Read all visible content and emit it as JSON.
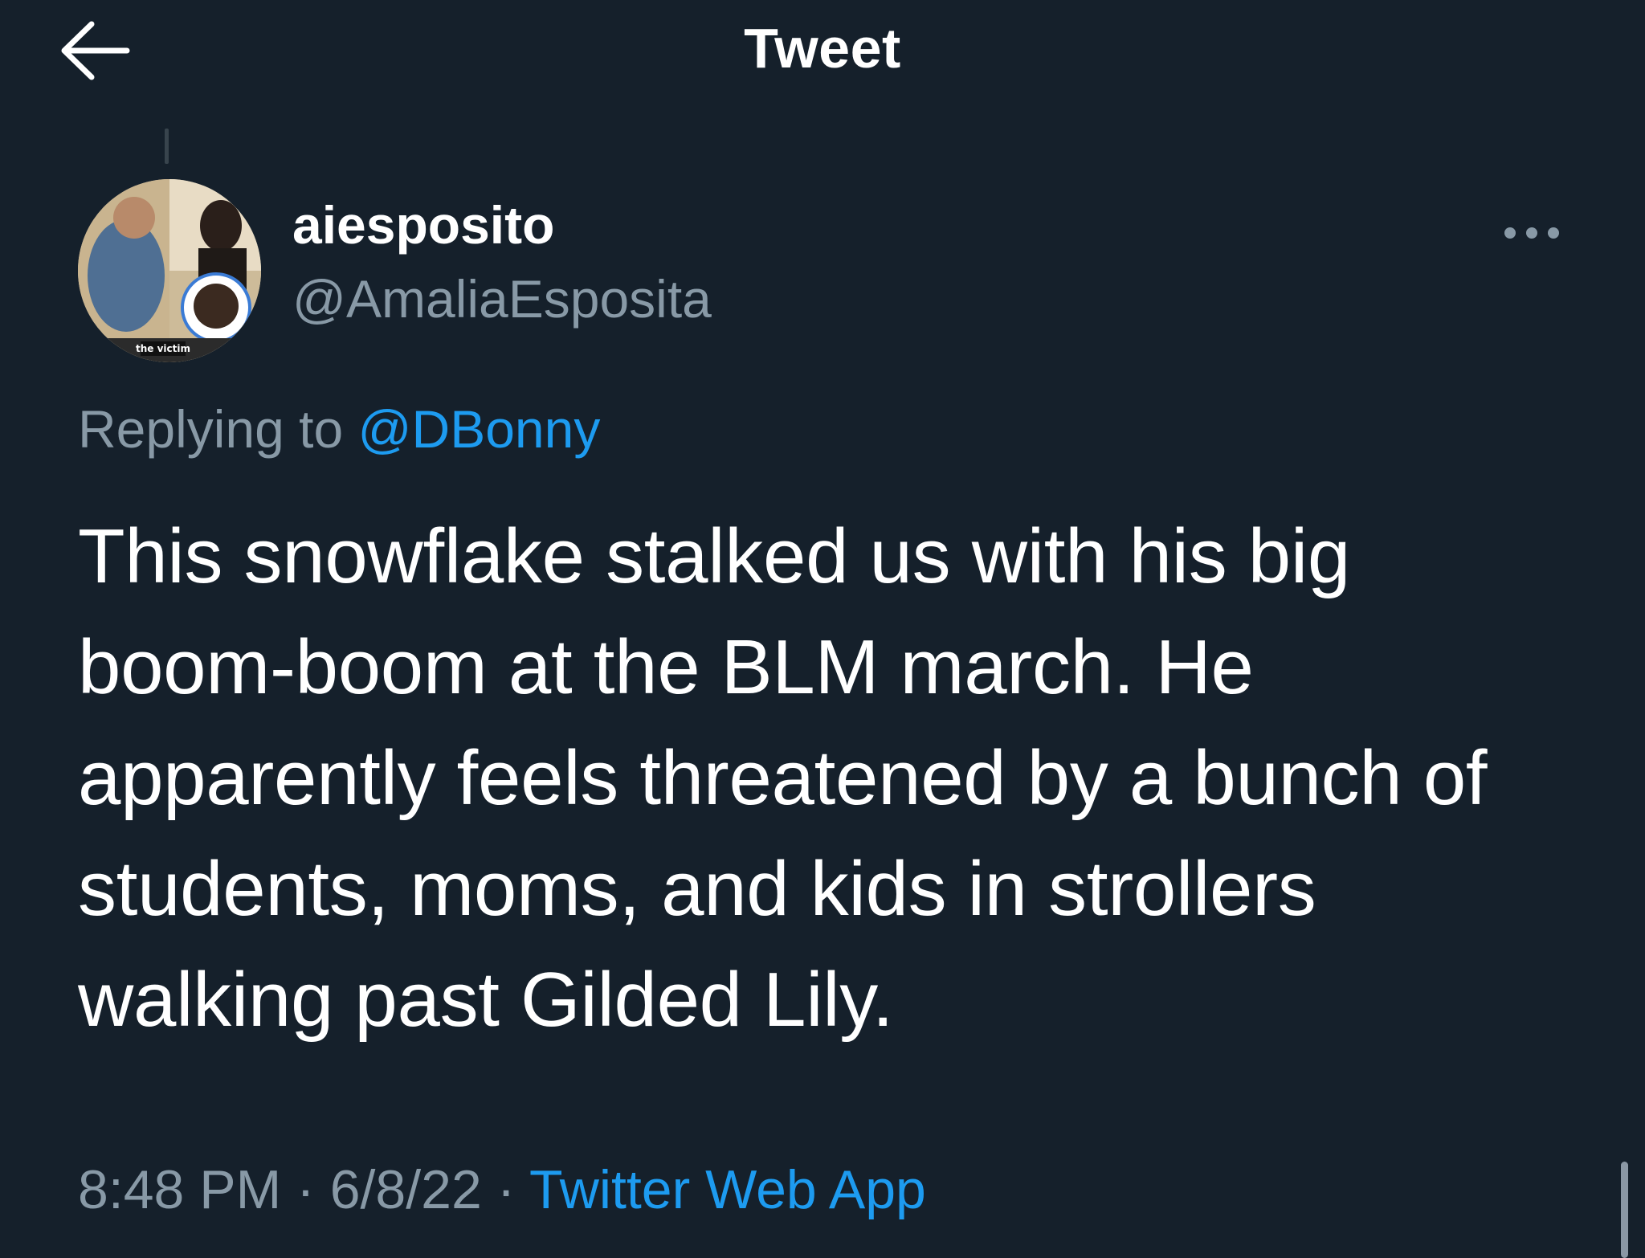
{
  "header": {
    "title": "Tweet",
    "back_icon": "arrow-left-icon"
  },
  "tweet": {
    "author": {
      "display_name": "aiesposito",
      "handle": "@AmaliaEsposita",
      "avatar_caption": "the victim"
    },
    "more_icon": "more-horizontal-icon",
    "replying_to_label": "Replying to",
    "replying_to_handle": "@DBonny",
    "text": "This snowflake stalked us with his big boom-boom at the BLM march. He apparently feels threatened by a bunch of students, moms, and kids in strollers walking past Gilded Lily.",
    "time": "8:48 PM",
    "separator": "·",
    "date": "6/8/22",
    "source": "Twitter Web App"
  },
  "colors": {
    "background": "#15202b",
    "primary_text": "#ffffff",
    "secondary_text": "#8899a6",
    "link": "#1d9bf0"
  }
}
